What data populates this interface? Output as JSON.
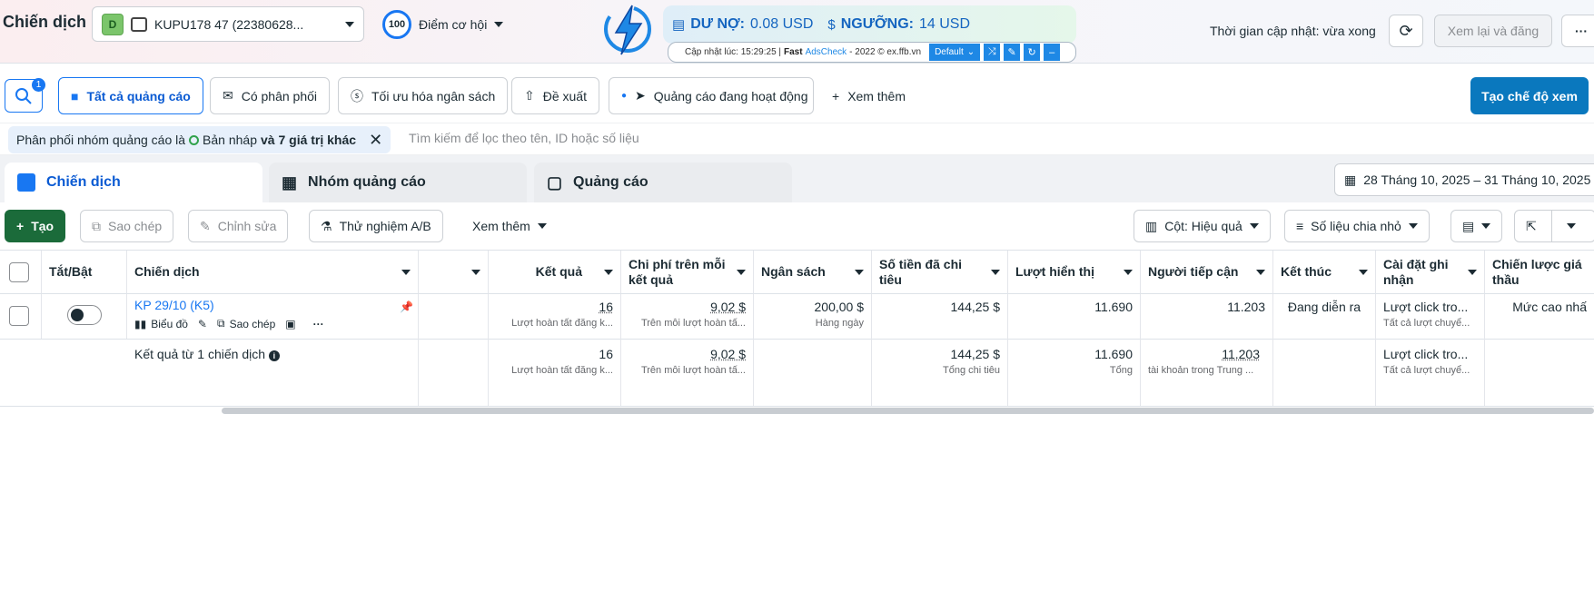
{
  "header": {
    "title": "Chiến dịch",
    "account_badge": "D",
    "account_name": "KUPU178 47 (22380628...",
    "score_value": "100",
    "score_label": "Điểm cơ hội",
    "update_time": "Thời gian cập nhật: vừa xong",
    "review_publish": "Xem lại và đăng",
    "more": "···"
  },
  "extension": {
    "debt_label": "DƯ NỢ:",
    "debt_value": "0.08 USD",
    "threshold_label": "NGƯỠNG:",
    "threshold_value": "14 USD",
    "updated_prefix": "Cập nhật lúc: 15:29:25 |",
    "fast": "Fast",
    "brand": "AdsCheck",
    "suffix": "- 2022 © ex.ffb.vn",
    "preset": "Default"
  },
  "filter_tabs": {
    "search_badge": "1",
    "all_ads": "Tất cả quảng cáo",
    "delivering": "Có phân phối",
    "budget_opt": "Tối ưu hóa ngân sách",
    "suggestions": "Đề xuất",
    "active_ads": "Quảng cáo đang hoạt động",
    "see_more": "Xem thêm",
    "create_view": "Tạo chế độ xem"
  },
  "filter_bar": {
    "chip_prefix": "Phân phối nhóm quảng cáo là",
    "chip_value": "Bản nháp",
    "chip_more": "và 7 giá trị khác",
    "search_placeholder": "Tìm kiếm để lọc theo tên, ID hoặc số liệu"
  },
  "level_tabs": {
    "campaigns": "Chiến dịch",
    "adsets": "Nhóm quảng cáo",
    "ads": "Quảng cáo",
    "date_range": "28 Tháng 10, 2025 – 31 Tháng 10, 2025"
  },
  "toolbar": {
    "create": "Tạo",
    "duplicate": "Sao chép",
    "edit": "Chỉnh sửa",
    "ab_test": "Thử nghiệm A/B",
    "see_more": "Xem thêm",
    "columns": "Cột: Hiệu quả",
    "breakdown": "Số liệu chia nhỏ"
  },
  "table": {
    "headers": {
      "toggle": "Tắt/Bật",
      "campaign": "Chiến dịch",
      "results": "Kết quả",
      "cost_per_result": "Chi phí trên mỗi kết quả",
      "budget": "Ngân sách",
      "amount_spent": "Số tiền đã chi tiêu",
      "impressions": "Lượt hiển thị",
      "reach": "Người tiếp cận",
      "ends": "Kết thúc",
      "attribution": "Cài đặt ghi nhận",
      "bid_strategy": "Chiến lược giá thầu"
    },
    "row": {
      "name": "KP 29/10 (K5)",
      "chart": "Biểu đồ",
      "duplicate": "Sao chép",
      "results": "16",
      "results_sub": "Lượt hoàn tất đăng k...",
      "cost": "9,02 $",
      "cost_sub": "Trên mỗi lượt hoàn tấ...",
      "budget": "200,00 $",
      "budget_sub": "Hàng ngày",
      "spent": "144,25 $",
      "impressions": "11.690",
      "reach": "11.203",
      "ends": "Đang diễn ra",
      "attribution": "Lượt click tro...",
      "attribution_sub": "Tất cả lượt chuyể...",
      "bid": "Mức cao nhấ"
    },
    "summary": {
      "label": "Kết quả từ 1 chiến dịch",
      "results": "16",
      "results_sub": "Lượt hoàn tất đăng k...",
      "cost": "9,02 $",
      "cost_sub": "Trên mỗi lượt hoàn tấ...",
      "spent": "144,25 $",
      "spent_sub": "Tổng chi tiêu",
      "impressions": "11.690",
      "impressions_sub": "Tổng",
      "reach": "11.203",
      "reach_sub": "tài khoản trong Trung ...",
      "attribution": "Lượt click tro...",
      "attribution_sub": "Tất cả lượt chuyể..."
    }
  }
}
